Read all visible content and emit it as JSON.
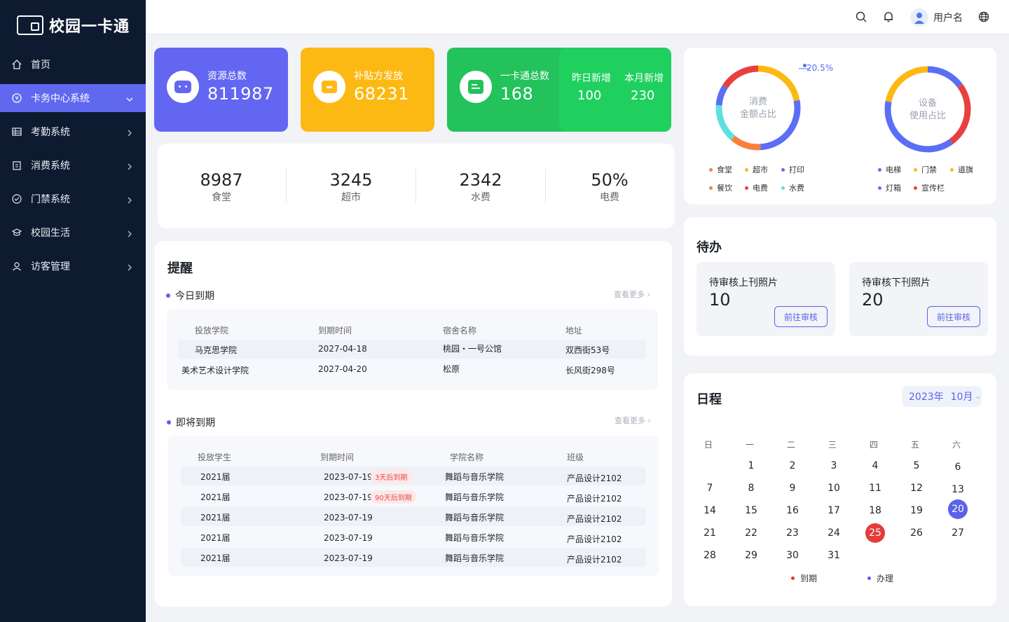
{
  "app": {
    "title": "校园一卡通"
  },
  "sidebar": {
    "items": [
      {
        "label": "首页",
        "icon": "home-icon",
        "active": false,
        "has_arrow": false
      },
      {
        "label": "卡务中心系统",
        "icon": "card-icon",
        "active": true,
        "has_arrow": true
      },
      {
        "label": "考勤系统",
        "icon": "grid-icon",
        "active": false,
        "has_arrow": true
      },
      {
        "label": "消费系统",
        "icon": "clipboard-icon",
        "active": false,
        "has_arrow": true
      },
      {
        "label": "门禁系统",
        "icon": "check-circle-icon",
        "active": false,
        "has_arrow": true
      },
      {
        "label": "校园生活",
        "icon": "graduation-cap-icon",
        "active": false,
        "has_arrow": true
      },
      {
        "label": "访客管理",
        "icon": "user-icon",
        "active": false,
        "has_arrow": true
      }
    ]
  },
  "header": {
    "username": "用户名",
    "icons": [
      "search-icon",
      "bell-icon",
      "avatar",
      "globe-icon"
    ]
  },
  "stats": {
    "resources": {
      "label": "资源总数",
      "value": "811987",
      "color": "#6366f1"
    },
    "subsidy": {
      "label": "补贴方发放",
      "value": "68231",
      "color": "#fdb913"
    },
    "cards": {
      "label": "一卡通总数",
      "value": "168",
      "color": "#23c25b",
      "yesterday_label": "昨日新增",
      "yesterday_value": "100",
      "month_label": "本月新增",
      "month_value": "230"
    }
  },
  "mini_stats": [
    {
      "value": "8987",
      "label": "食堂"
    },
    {
      "value": "3245",
      "label": "超市"
    },
    {
      "value": "2342",
      "label": "水费"
    },
    {
      "value": "50%",
      "label": "电费"
    }
  ],
  "charts": {
    "consumption": {
      "label_line1": "消费",
      "label_line2": "金额占比",
      "callout": "20.5%",
      "legend": [
        {
          "name": "食堂",
          "color": "#f97f3c"
        },
        {
          "name": "超市",
          "color": "#fdb913"
        },
        {
          "name": "打印",
          "color": "#5b6ef5"
        },
        {
          "name": "餐饮",
          "color": "#f97f3c"
        },
        {
          "name": "电费",
          "color": "#e84040"
        },
        {
          "name": "水费",
          "color": "#5ee0e0"
        }
      ]
    },
    "device": {
      "label_line1": "设备",
      "label_line2": "使用占比",
      "legend": [
        {
          "name": "电梯",
          "color": "#5b6ef5"
        },
        {
          "name": "门禁",
          "color": "#fdb913"
        },
        {
          "name": "道旗",
          "color": "#fdb913"
        },
        {
          "name": "灯箱",
          "color": "#5b6ef5"
        },
        {
          "name": "宣传栏",
          "color": "#e84040"
        }
      ]
    }
  },
  "reminder": {
    "title": "提醒",
    "today": {
      "title": "今日到期",
      "more": "查看更多",
      "headers": [
        "投放学院",
        "到期时间",
        "宿舍名称",
        "地址"
      ],
      "rows": [
        [
          "马克思学院",
          "2027-04-18",
          "桃园・一号公馆",
          "双西街53号"
        ],
        [
          "美术艺术设计学院",
          "2027-04-20",
          "松原",
          "长风街298号"
        ]
      ]
    },
    "soon": {
      "title": "即将到期",
      "more": "查看更多",
      "headers": [
        "投放学生",
        "到期时间",
        "学院名称",
        "班级"
      ],
      "rows": [
        {
          "student": "2021届",
          "date": "2023-07-19",
          "tag": "3天后到期",
          "college": "舞蹈与音乐学院",
          "class": "产品设计2102"
        },
        {
          "student": "2021届",
          "date": "2023-07-19",
          "tag": "90天后到期",
          "college": "舞蹈与音乐学院",
          "class": "产品设计2102"
        },
        {
          "student": "2021届",
          "date": "2023-07-19",
          "tag": "",
          "college": "舞蹈与音乐学院",
          "class": "产品设计2102"
        },
        {
          "student": "2021届",
          "date": "2023-07-19",
          "tag": "",
          "college": "舞蹈与音乐学院",
          "class": "产品设计2102"
        },
        {
          "student": "2021届",
          "date": "2023-07-19",
          "tag": "",
          "college": "舞蹈与音乐学院",
          "class": "产品设计2102"
        }
      ]
    }
  },
  "todo": {
    "title": "待办",
    "items": [
      {
        "title": "待审核上刊照片",
        "count": "10",
        "button": "前往审核"
      },
      {
        "title": "待审核下刊照片",
        "count": "20",
        "button": "前往审核"
      }
    ]
  },
  "calendar": {
    "title": "日程",
    "year": "2023年",
    "month": "10月",
    "weekdays": [
      "日",
      "一",
      "二",
      "三",
      "四",
      "五",
      "六"
    ],
    "days": [
      "1",
      "2",
      "3",
      "4",
      "5",
      "6",
      "7",
      "8",
      "9",
      "10",
      "11",
      "12",
      "13",
      "14",
      "15",
      "16",
      "17",
      "18",
      "19",
      "20",
      "21",
      "22",
      "23",
      "24",
      "25",
      "26",
      "27",
      "28",
      "29",
      "30",
      "31"
    ],
    "today": "20",
    "due": "25",
    "legend": [
      {
        "name": "到期",
        "color": "#e63b3b"
      },
      {
        "name": "办理",
        "color": "#5a62e8"
      }
    ]
  }
}
